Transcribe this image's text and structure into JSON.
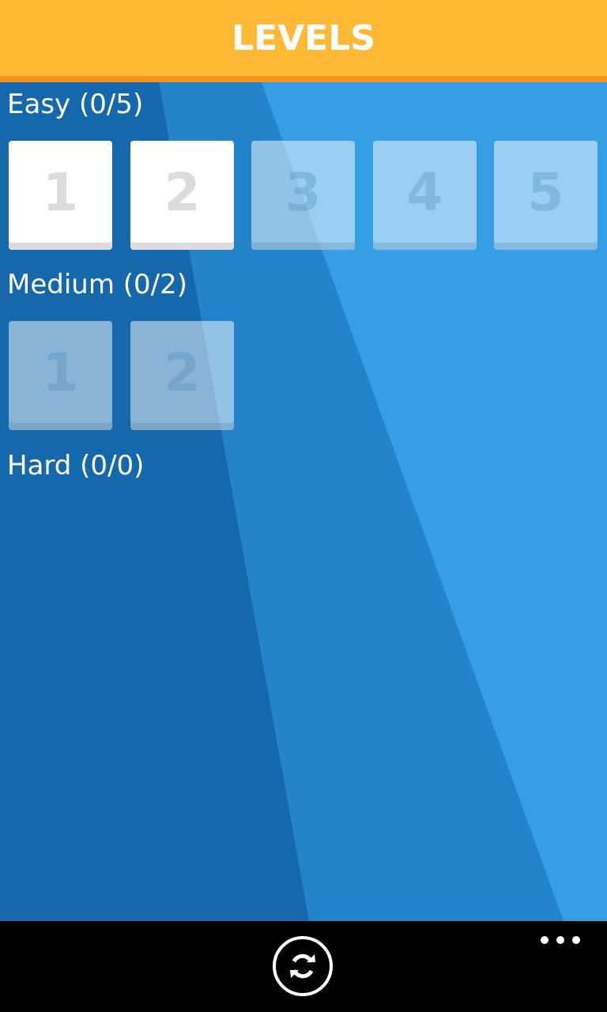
{
  "header": {
    "title": "LEVELS"
  },
  "colors": {
    "header": "#FFB935",
    "header_underline": "#F7941D",
    "background_dark": "#1468AB",
    "background_mid": "#2484CB",
    "background_light": "#359FE6",
    "appbar": "#000000"
  },
  "sections": [
    {
      "title": "Easy (0/5)",
      "levels": [
        {
          "label": "1",
          "state": "unlocked"
        },
        {
          "label": "2",
          "state": "unlocked"
        },
        {
          "label": "3",
          "state": "locked"
        },
        {
          "label": "4",
          "state": "locked"
        },
        {
          "label": "5",
          "state": "locked"
        }
      ]
    },
    {
      "title": "Medium (0/2)",
      "levels": [
        {
          "label": "1",
          "state": "locked"
        },
        {
          "label": "2",
          "state": "locked"
        }
      ]
    },
    {
      "title": "Hard (0/0)",
      "levels": []
    }
  ],
  "appbar": {
    "refresh_icon": "refresh-icon",
    "more_icon": "more-dots-icon"
  }
}
